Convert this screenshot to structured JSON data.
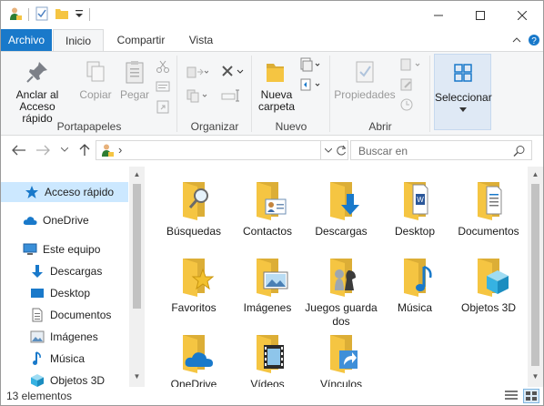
{
  "qat": {
    "icons": [
      "user-folder-icon",
      "properties-checkbox-icon",
      "new-folder-icon",
      "customize-qat-icon"
    ]
  },
  "ribbon_tabs": [
    {
      "label": "Archivo"
    },
    {
      "label": "Inicio"
    },
    {
      "label": "Compartir"
    },
    {
      "label": "Vista"
    }
  ],
  "ribbon": {
    "portapapeles": {
      "group_label": "Portapapeles",
      "pin_label_1": "Anclar al",
      "pin_label_2": "Acceso rápido",
      "copy_label": "Copiar",
      "paste_label": "Pegar"
    },
    "organizar": {
      "group_label": "Organizar"
    },
    "nuevo": {
      "group_label": "Nuevo",
      "new_folder_label_1": "Nueva",
      "new_folder_label_2": "carpeta"
    },
    "abrir": {
      "group_label": "Abrir",
      "properties_label": "Propiedades"
    },
    "seleccionar": {
      "label": "Seleccionar"
    }
  },
  "address": {
    "path_separator": "›",
    "search_placeholder": "Buscar en"
  },
  "nav_pane": {
    "items": [
      {
        "label": "Acceso rápido",
        "icon": "star-icon"
      },
      {
        "label": "OneDrive",
        "icon": "cloud-icon"
      },
      {
        "label": "Este equipo",
        "icon": "computer-icon"
      },
      {
        "label": "Descargas",
        "icon": "download-arrow-icon"
      },
      {
        "label": "Desktop",
        "icon": "desktop-icon"
      },
      {
        "label": "Documentos",
        "icon": "document-icon"
      },
      {
        "label": "Imágenes",
        "icon": "pictures-icon"
      },
      {
        "label": "Música",
        "icon": "music-note-icon"
      },
      {
        "label": "Objetos 3D",
        "icon": "cube-3d-icon"
      }
    ]
  },
  "folders": [
    {
      "label": "Búsquedas",
      "icon": "search-folder-icon"
    },
    {
      "label": "Contactos",
      "icon": "contacts-folder-icon"
    },
    {
      "label": "Descargas",
      "icon": "downloads-folder-icon"
    },
    {
      "label": "Desktop",
      "icon": "desktop-folder-icon"
    },
    {
      "label": "Documentos",
      "icon": "documents-folder-icon"
    },
    {
      "label": "Favoritos",
      "icon": "favorites-folder-icon"
    },
    {
      "label": "Imágenes",
      "icon": "pictures-folder-icon"
    },
    {
      "label": "Juegos guardados",
      "icon": "saved-games-folder-icon"
    },
    {
      "label": "Música",
      "icon": "music-folder-icon"
    },
    {
      "label": "Objetos 3D",
      "icon": "3d-objects-folder-icon"
    },
    {
      "label": "OneDrive",
      "icon": "onedrive-folder-icon"
    },
    {
      "label": "Vídeos",
      "icon": "videos-folder-icon"
    },
    {
      "label": "Vínculos",
      "icon": "links-folder-icon"
    }
  ],
  "status": {
    "item_count": "13 elementos"
  },
  "colors": {
    "accent": "#1979ca",
    "folder": "#f5c542",
    "selection": "#cce8ff"
  }
}
